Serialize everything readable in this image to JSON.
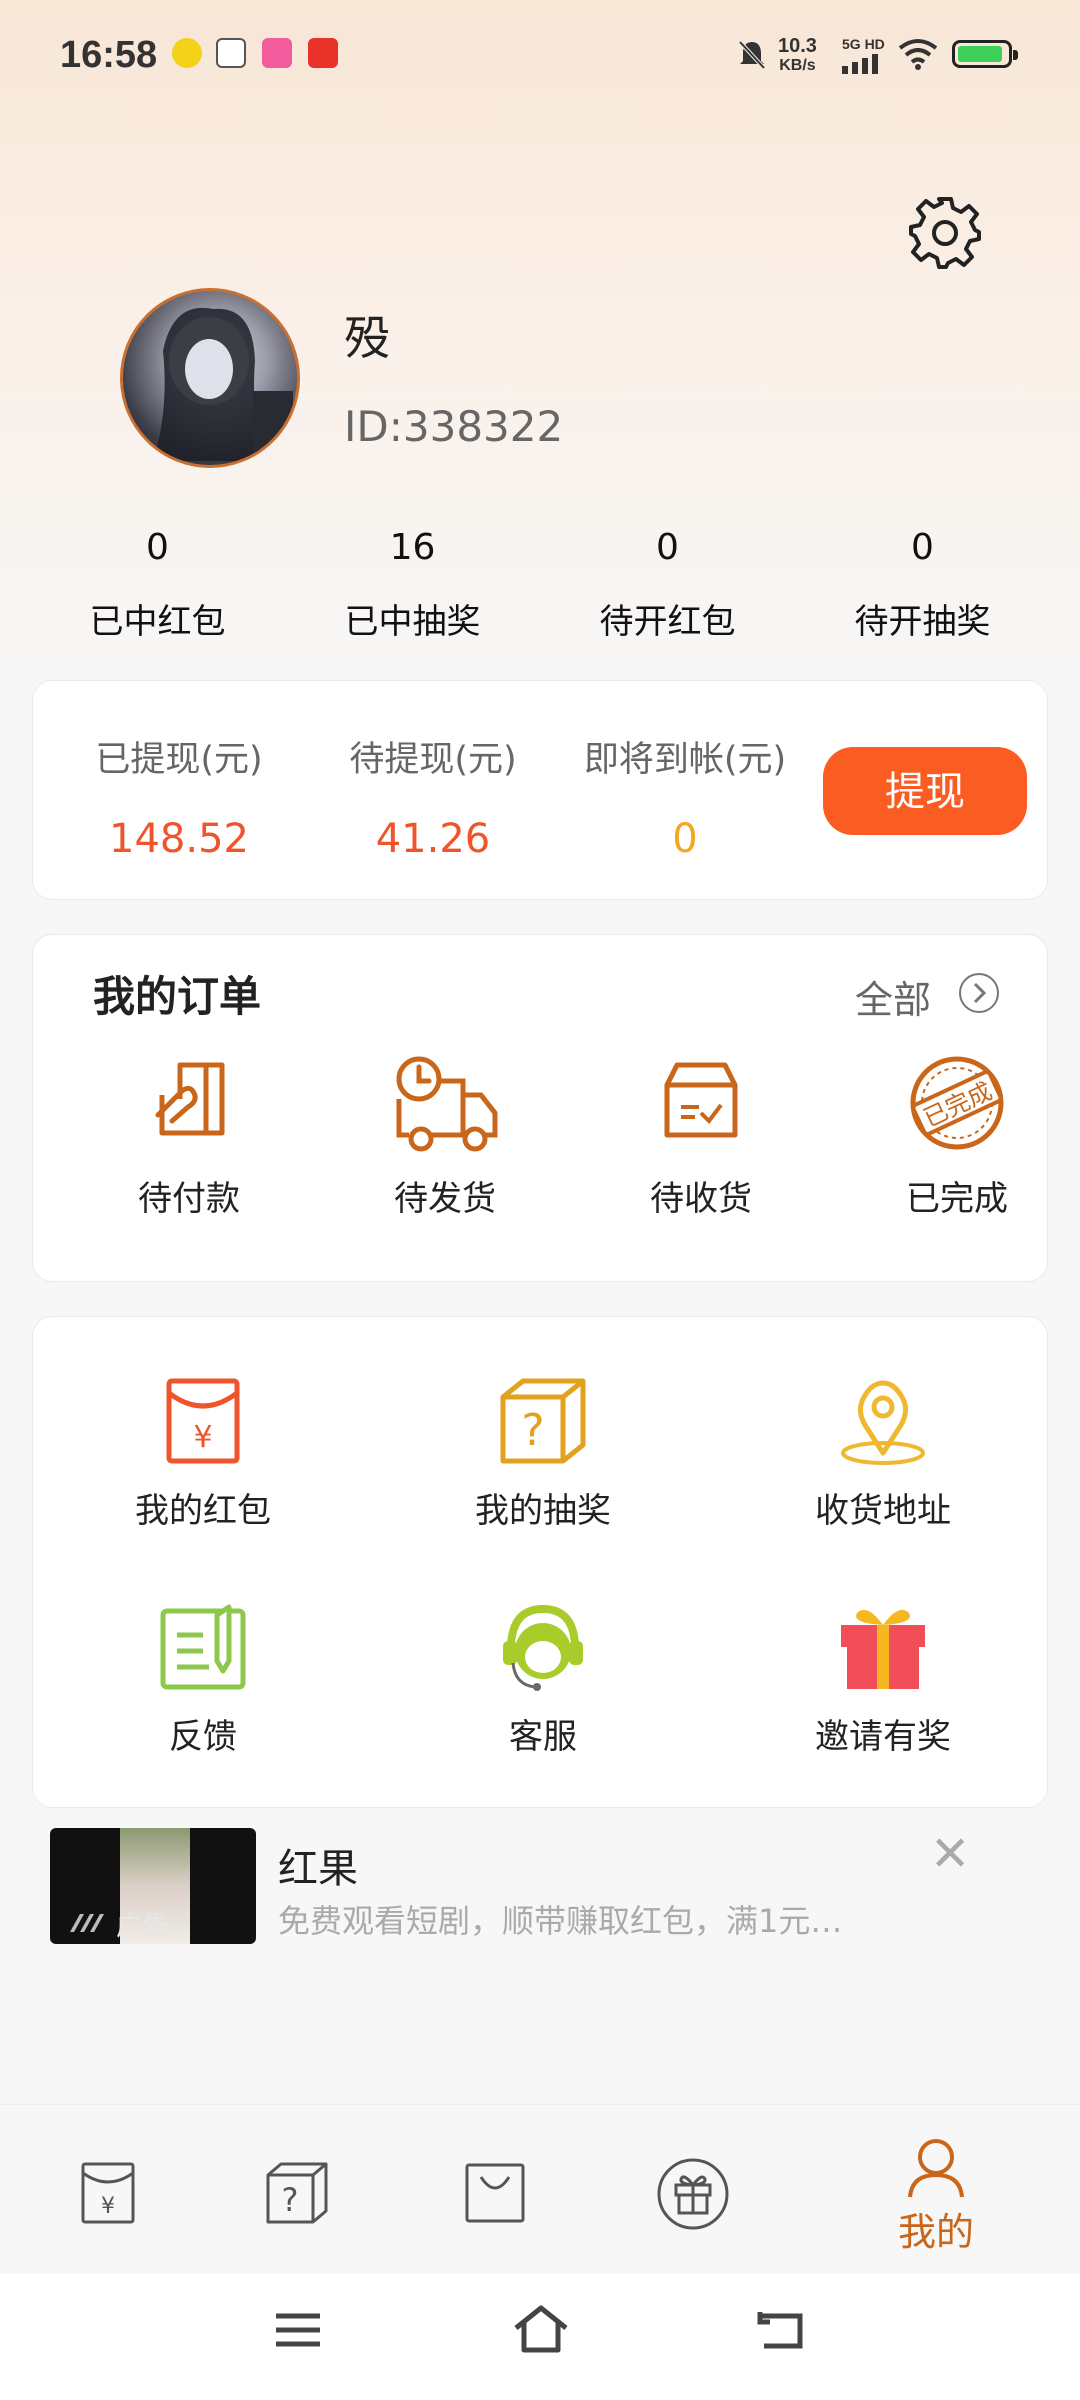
{
  "status_bar": {
    "time": "16:58",
    "net_speed": "10.3",
    "net_unit": "KB/s",
    "signal": "5G HD",
    "battery_color": "#3ccf5a"
  },
  "header": {
    "settings_icon": "gear-icon",
    "username": "殁",
    "user_id": "ID:338322"
  },
  "stats": [
    {
      "value": "0",
      "label": "已中红包"
    },
    {
      "value": "16",
      "label": "已中抽奖"
    },
    {
      "value": "0",
      "label": "待开红包"
    },
    {
      "value": "0",
      "label": "待开抽奖"
    }
  ],
  "withdraw": {
    "items": [
      {
        "label": "已提现(元)",
        "value": "148.52",
        "color": "#f0542b"
      },
      {
        "label": "待提现(元)",
        "value": "41.26",
        "color": "#f0542b"
      },
      {
        "label": "即将到帐(元)",
        "value": "0",
        "color": "#f5a623"
      }
    ],
    "button_label": "提现",
    "button_color": "#fa5c22"
  },
  "orders": {
    "title": "我的订单",
    "all_label": "全部",
    "items": [
      {
        "label": "待付款",
        "icon": "payment-icon"
      },
      {
        "label": "待发货",
        "icon": "delivery-truck-icon"
      },
      {
        "label": "待收货",
        "icon": "receive-box-icon"
      },
      {
        "label": "已完成",
        "icon": "completed-stamp-icon",
        "stamp_text": "已完成"
      }
    ],
    "accent": "#c9661a"
  },
  "services": [
    {
      "label": "我的红包",
      "icon": "red-envelope-icon"
    },
    {
      "label": "我的抽奖",
      "icon": "mystery-box-icon"
    },
    {
      "label": "收货地址",
      "icon": "location-pin-icon"
    },
    {
      "label": "反馈",
      "icon": "feedback-icon"
    },
    {
      "label": "客服",
      "icon": "customer-service-icon"
    },
    {
      "label": "邀请有奖",
      "icon": "gift-icon"
    }
  ],
  "ad": {
    "badge": "广告",
    "title": "红果",
    "description": "免费观看短剧，顺带赚取红包，满1元…"
  },
  "tabbar": {
    "items": [
      {
        "icon": "red-envelope-tab-icon"
      },
      {
        "icon": "lottery-box-tab-icon"
      },
      {
        "icon": "shopping-bag-tab-icon"
      },
      {
        "icon": "gift-tab-icon"
      },
      {
        "icon": "profile-tab-icon",
        "label": "我的"
      }
    ],
    "active_color": "#c9661a"
  }
}
